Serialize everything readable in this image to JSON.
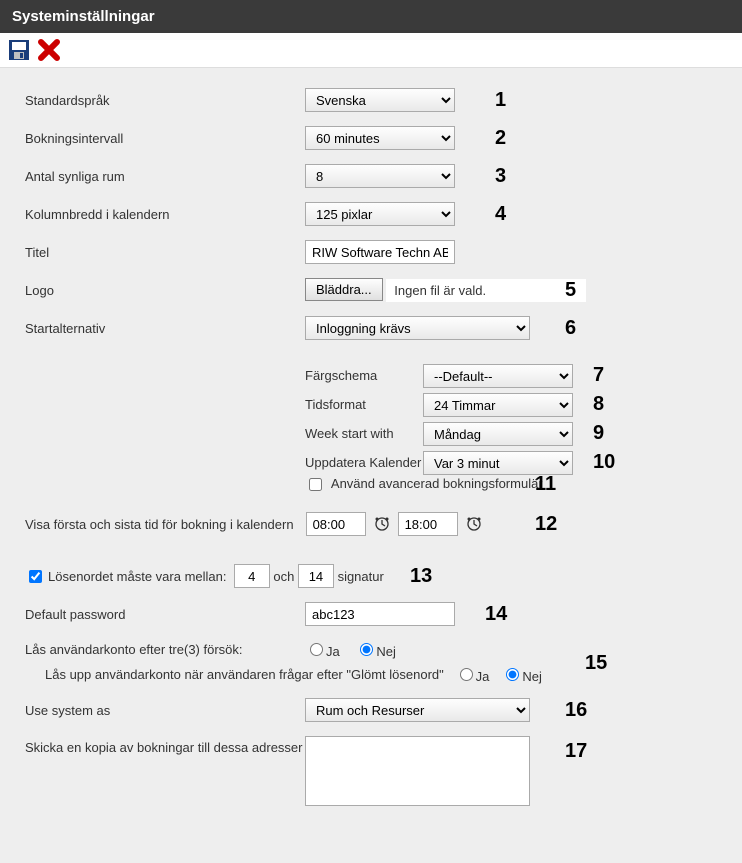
{
  "header": {
    "title": "Systeminställningar"
  },
  "labels": {
    "default_language": "Standardspråk",
    "booking_interval": "Bokningsintervall",
    "visible_rooms": "Antal synliga rum",
    "column_width": "Kolumnbredd i kalendern",
    "title_field": "Titel",
    "logo": "Logo",
    "browse_button": "Bläddra...",
    "no_file": "Ingen fil är vald.",
    "start_option": "Startalternativ",
    "color_scheme": "Färgschema",
    "time_format": "Tidsformat",
    "week_start": "Week start with",
    "refresh_calendar": "Uppdatera Kalender",
    "advanced_form": "Använd avancerad bokningsformulär",
    "show_times": "Visa första och sista tid för bokning i kalendern",
    "password_between": "Lösenordet måste vara mellan:",
    "and": "och",
    "signature": "signatur",
    "default_password": "Default password",
    "lock_after_three": "Lås användarkonto efter tre(3) försök:",
    "unlock_forgot": "Lås upp användarkonto när användaren frågar efter \"Glömt lösenord\"",
    "yes": "Ja",
    "no": "Nej",
    "use_system_as": "Use system as",
    "copy_bookings": "Skicka en kopia av bokningar till dessa adresser"
  },
  "values": {
    "default_language": "Svenska",
    "booking_interval": "60 minutes",
    "visible_rooms": "8",
    "column_width": "125 pixlar",
    "title_field": "RIW Software Techn AB",
    "start_option": "Inloggning krävs",
    "color_scheme": "--Default--",
    "time_format": "24 Timmar",
    "week_start": "Måndag",
    "refresh_calendar": "Var 3 minut",
    "advanced_form_checked": false,
    "time_start": "08:00",
    "time_end": "18:00",
    "password_enforce_checked": true,
    "password_min": "4",
    "password_max": "14",
    "default_password": "abc123",
    "lock_after_three": "Nej",
    "unlock_forgot": "Nej",
    "use_system_as": "Rum och Resurser",
    "copy_addresses": ""
  },
  "annotations": {
    "a1": "1",
    "a2": "2",
    "a3": "3",
    "a4": "4",
    "a5": "5",
    "a6": "6",
    "a7": "7",
    "a8": "8",
    "a9": "9",
    "a10": "10",
    "a11": "11",
    "a12": "12",
    "a13": "13",
    "a14": "14",
    "a15": "15",
    "a16": "16",
    "a17": "17"
  }
}
